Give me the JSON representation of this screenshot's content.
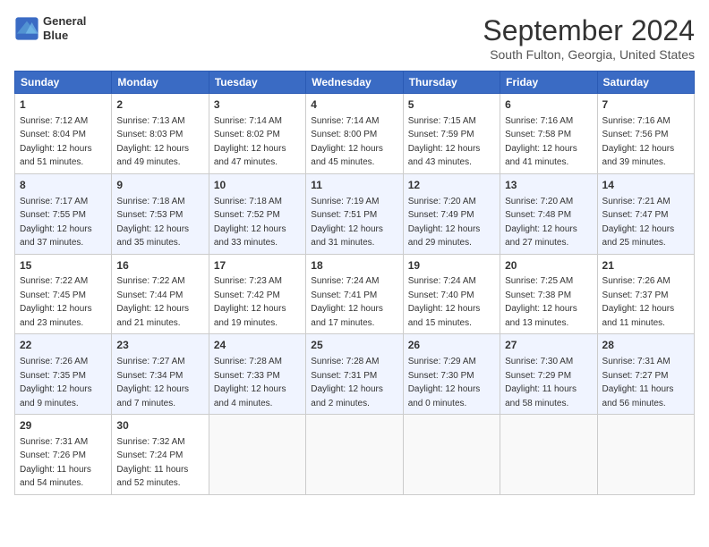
{
  "header": {
    "logo_line1": "General",
    "logo_line2": "Blue",
    "month": "September 2024",
    "location": "South Fulton, Georgia, United States"
  },
  "days_of_week": [
    "Sunday",
    "Monday",
    "Tuesday",
    "Wednesday",
    "Thursday",
    "Friday",
    "Saturday"
  ],
  "weeks": [
    [
      {
        "day": "1",
        "sunrise": "7:12 AM",
        "sunset": "8:04 PM",
        "daylight": "12 hours and 51 minutes."
      },
      {
        "day": "2",
        "sunrise": "7:13 AM",
        "sunset": "8:03 PM",
        "daylight": "12 hours and 49 minutes."
      },
      {
        "day": "3",
        "sunrise": "7:14 AM",
        "sunset": "8:02 PM",
        "daylight": "12 hours and 47 minutes."
      },
      {
        "day": "4",
        "sunrise": "7:14 AM",
        "sunset": "8:00 PM",
        "daylight": "12 hours and 45 minutes."
      },
      {
        "day": "5",
        "sunrise": "7:15 AM",
        "sunset": "7:59 PM",
        "daylight": "12 hours and 43 minutes."
      },
      {
        "day": "6",
        "sunrise": "7:16 AM",
        "sunset": "7:58 PM",
        "daylight": "12 hours and 41 minutes."
      },
      {
        "day": "7",
        "sunrise": "7:16 AM",
        "sunset": "7:56 PM",
        "daylight": "12 hours and 39 minutes."
      }
    ],
    [
      {
        "day": "8",
        "sunrise": "7:17 AM",
        "sunset": "7:55 PM",
        "daylight": "12 hours and 37 minutes."
      },
      {
        "day": "9",
        "sunrise": "7:18 AM",
        "sunset": "7:53 PM",
        "daylight": "12 hours and 35 minutes."
      },
      {
        "day": "10",
        "sunrise": "7:18 AM",
        "sunset": "7:52 PM",
        "daylight": "12 hours and 33 minutes."
      },
      {
        "day": "11",
        "sunrise": "7:19 AM",
        "sunset": "7:51 PM",
        "daylight": "12 hours and 31 minutes."
      },
      {
        "day": "12",
        "sunrise": "7:20 AM",
        "sunset": "7:49 PM",
        "daylight": "12 hours and 29 minutes."
      },
      {
        "day": "13",
        "sunrise": "7:20 AM",
        "sunset": "7:48 PM",
        "daylight": "12 hours and 27 minutes."
      },
      {
        "day": "14",
        "sunrise": "7:21 AM",
        "sunset": "7:47 PM",
        "daylight": "12 hours and 25 minutes."
      }
    ],
    [
      {
        "day": "15",
        "sunrise": "7:22 AM",
        "sunset": "7:45 PM",
        "daylight": "12 hours and 23 minutes."
      },
      {
        "day": "16",
        "sunrise": "7:22 AM",
        "sunset": "7:44 PM",
        "daylight": "12 hours and 21 minutes."
      },
      {
        "day": "17",
        "sunrise": "7:23 AM",
        "sunset": "7:42 PM",
        "daylight": "12 hours and 19 minutes."
      },
      {
        "day": "18",
        "sunrise": "7:24 AM",
        "sunset": "7:41 PM",
        "daylight": "12 hours and 17 minutes."
      },
      {
        "day": "19",
        "sunrise": "7:24 AM",
        "sunset": "7:40 PM",
        "daylight": "12 hours and 15 minutes."
      },
      {
        "day": "20",
        "sunrise": "7:25 AM",
        "sunset": "7:38 PM",
        "daylight": "12 hours and 13 minutes."
      },
      {
        "day": "21",
        "sunrise": "7:26 AM",
        "sunset": "7:37 PM",
        "daylight": "12 hours and 11 minutes."
      }
    ],
    [
      {
        "day": "22",
        "sunrise": "7:26 AM",
        "sunset": "7:35 PM",
        "daylight": "12 hours and 9 minutes."
      },
      {
        "day": "23",
        "sunrise": "7:27 AM",
        "sunset": "7:34 PM",
        "daylight": "12 hours and 7 minutes."
      },
      {
        "day": "24",
        "sunrise": "7:28 AM",
        "sunset": "7:33 PM",
        "daylight": "12 hours and 4 minutes."
      },
      {
        "day": "25",
        "sunrise": "7:28 AM",
        "sunset": "7:31 PM",
        "daylight": "12 hours and 2 minutes."
      },
      {
        "day": "26",
        "sunrise": "7:29 AM",
        "sunset": "7:30 PM",
        "daylight": "12 hours and 0 minutes."
      },
      {
        "day": "27",
        "sunrise": "7:30 AM",
        "sunset": "7:29 PM",
        "daylight": "11 hours and 58 minutes."
      },
      {
        "day": "28",
        "sunrise": "7:31 AM",
        "sunset": "7:27 PM",
        "daylight": "11 hours and 56 minutes."
      }
    ],
    [
      {
        "day": "29",
        "sunrise": "7:31 AM",
        "sunset": "7:26 PM",
        "daylight": "11 hours and 54 minutes."
      },
      {
        "day": "30",
        "sunrise": "7:32 AM",
        "sunset": "7:24 PM",
        "daylight": "11 hours and 52 minutes."
      },
      null,
      null,
      null,
      null,
      null
    ]
  ]
}
